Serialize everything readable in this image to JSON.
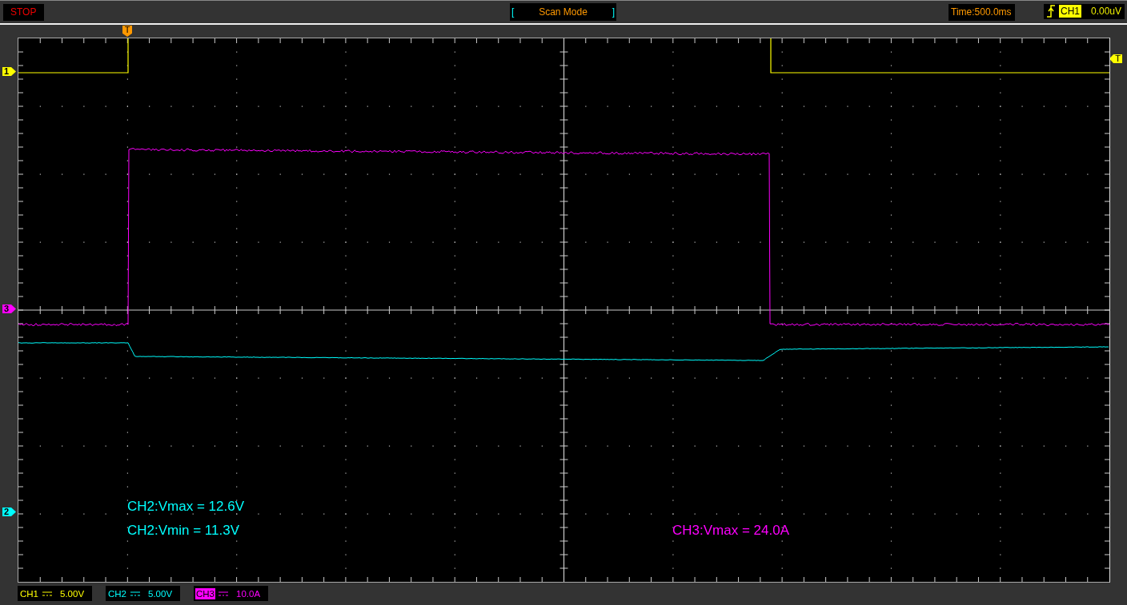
{
  "status": "STOP",
  "mode": {
    "open": "[",
    "label": "Scan Mode",
    "close": "]"
  },
  "timebase": "Time:500.0ms",
  "trigger": {
    "channel": "CH1",
    "level": "0.00uV",
    "color": "#ffff00"
  },
  "trigger_markers": [
    "T",
    "T"
  ],
  "channel_markers": [
    {
      "label": "1",
      "color": "#ffff00"
    },
    {
      "label": "3",
      "color": "#ff00ff"
    },
    {
      "label": "2",
      "color": "#00ffff"
    }
  ],
  "measurements": [
    {
      "text": "CH2:Vmax = 12.6V",
      "color": "#00ffff"
    },
    {
      "text": "CH2:Vmin = 11.3V",
      "color": "#00ffff"
    },
    {
      "text": "CH3:Vmax = 24.0A",
      "color": "#ff00ff"
    }
  ],
  "channels": [
    {
      "name": "CH1",
      "scale": "5.00V",
      "color": "#ffff00",
      "selected": false
    },
    {
      "name": "CH2",
      "scale": "5.00V",
      "color": "#00ffff",
      "selected": false
    },
    {
      "name": "CH3",
      "scale": "10.0A",
      "color": "#ff00ff",
      "selected": true
    }
  ]
}
